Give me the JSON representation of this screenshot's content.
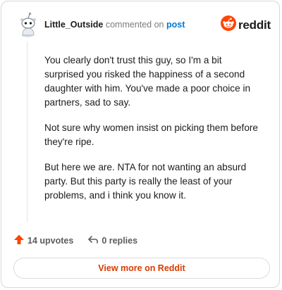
{
  "comment": {
    "author": "Little_Outside",
    "action_text": "commented on",
    "post_link_label": "post",
    "paragraphs": [
      "You clearly don't trust this guy, so I'm a bit surprised you risked the happiness of a second daughter with him. You've made a poor choice in partners, sad to say.",
      "Not sure why women insist on picking them before they're ripe.",
      "But here we are. NTA for not wanting an absurd party. But this party is really the least of your problems, and i think you know it."
    ]
  },
  "brand": {
    "wordmark": "reddit",
    "icon": "reddit-logo-icon",
    "color": "#ff4500"
  },
  "stats": {
    "upvotes_label": "14 upvotes",
    "upvote_icon": "upvote-arrow-icon",
    "replies_label": "0 replies",
    "reply_icon": "reply-arrow-icon"
  },
  "footer": {
    "view_more_label": "View more on Reddit"
  },
  "colors": {
    "accent": "#ff4500",
    "link": "#0079d3",
    "cta": "#d93a00"
  }
}
